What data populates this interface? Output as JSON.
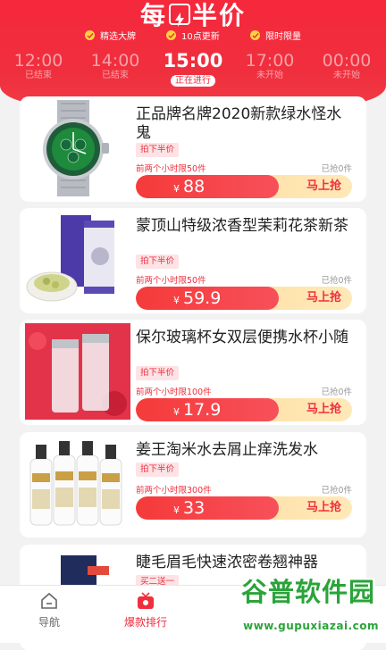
{
  "header": {
    "title_left": "每",
    "title_right": "半价",
    "features": [
      "精选大牌",
      "10点更新",
      "限时限量"
    ],
    "accent_color": "#ef2f3e"
  },
  "time_slots": [
    {
      "time": "12:00",
      "status": "已结束"
    },
    {
      "time": "14:00",
      "status": "已结束"
    },
    {
      "time": "15:00",
      "status": "正在进行"
    },
    {
      "time": "17:00",
      "status": "未开始"
    },
    {
      "time": "00:00",
      "status": "未开始"
    }
  ],
  "products": [
    {
      "name": "正品牌名牌2020新款绿水怪水鬼",
      "tag": "拍下半价",
      "limit": "前两个小时限50件",
      "sold": "已抢0件",
      "currency": "¥",
      "price": "88",
      "buy": "马上抢"
    },
    {
      "name": "蒙顶山特级浓香型茉莉花茶新茶",
      "tag": "拍下半价",
      "limit": "前两个小时限50件",
      "sold": "已抢0件",
      "currency": "¥",
      "price": "59.9",
      "buy": "马上抢"
    },
    {
      "name": "保尔玻璃杯女双层便携水杯小随",
      "tag": "拍下半价",
      "limit": "前两个小时限100件",
      "sold": "已抢0件",
      "currency": "¥",
      "price": "17.9",
      "buy": "马上抢"
    },
    {
      "name": "姜王淘米水去屑止痒洗发水",
      "tag": "拍下半价",
      "limit": "前两个小时限300件",
      "sold": "已抢0件",
      "currency": "¥",
      "price": "33",
      "buy": "马上抢"
    },
    {
      "name": "睫毛眉毛快速浓密卷翘神器",
      "tag": "买二送一"
    }
  ],
  "tabbar": [
    {
      "label": "导航",
      "icon": "home-icon"
    },
    {
      "label": "爆款排行",
      "icon": "tv-icon",
      "active": true
    }
  ],
  "watermark": {
    "main": "谷普软件园",
    "url": "www.gupuxiazai.com"
  }
}
